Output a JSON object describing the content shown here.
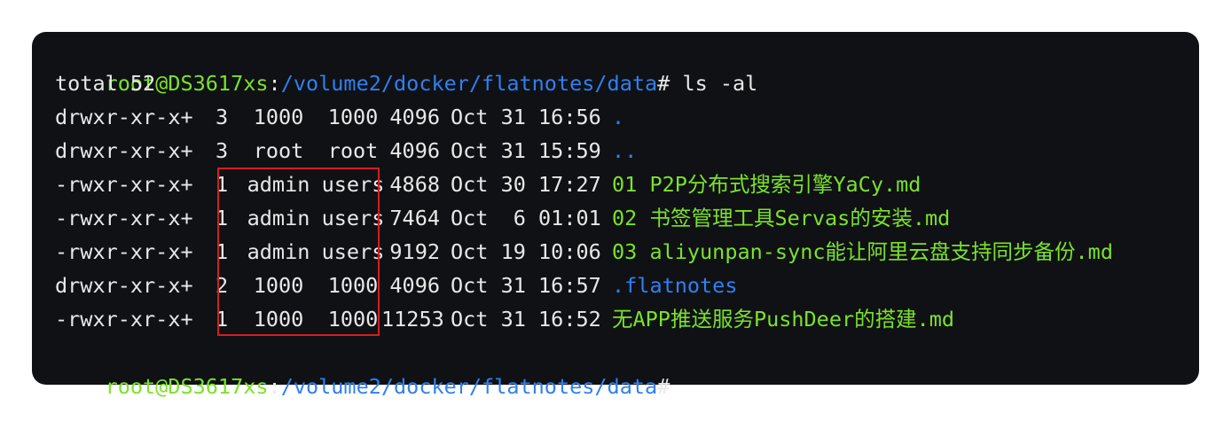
{
  "colors": {
    "background": "#0f1115",
    "text": "#e8e8e8",
    "prompt_green": "#7be22a",
    "path_blue": "#2f80f0",
    "highlight_red": "#d21f1f"
  },
  "prompt": {
    "user_host": "root@DS3617xs",
    "separator": ":",
    "path": "/volume2/docker/flatnotes/data",
    "symbol": "#"
  },
  "command": " ls -al",
  "total_line": "total 52",
  "rows": [
    {
      "perms": "drwxr-xr-x+",
      "links": "3",
      "owner": "1000",
      "group": "1000",
      "size": "4096",
      "date": "Oct 31 16:56",
      "name": ".",
      "name_color": "blue"
    },
    {
      "perms": "drwxr-xr-x+",
      "links": "3",
      "owner": "root",
      "group": "root",
      "size": "4096",
      "date": "Oct 31 15:59",
      "name": "..",
      "name_color": "blue"
    },
    {
      "perms": "-rwxr-xr-x+",
      "links": "1",
      "owner": "admin",
      "group": "users",
      "size": "4868",
      "date": "Oct 30 17:27",
      "name": "01 P2P分布式搜索引擎YaCy.md",
      "name_color": "green"
    },
    {
      "perms": "-rwxr-xr-x+",
      "links": "1",
      "owner": "admin",
      "group": "users",
      "size": "7464",
      "date": "Oct  6 01:01",
      "name": "02 书签管理工具Servas的安装.md",
      "name_color": "green"
    },
    {
      "perms": "-rwxr-xr-x+",
      "links": "1",
      "owner": "admin",
      "group": "users",
      "size": "9192",
      "date": "Oct 19 10:06",
      "name": "03 aliyunpan-sync能让阿里云盘支持同步备份.md",
      "name_color": "green"
    },
    {
      "perms": "drwxr-xr-x+",
      "links": "2",
      "owner": "1000",
      "group": "1000",
      "size": "4096",
      "date": "Oct 31 16:57",
      "name": ".flatnotes",
      "name_color": "blue"
    },
    {
      "perms": "-rwxr-xr-x+",
      "links": "1",
      "owner": "1000",
      "group": "1000",
      "size": "11253",
      "date": "Oct 31 16:52",
      "name": "无APP推送服务PushDeer的搭建.md",
      "name_color": "green"
    }
  ]
}
